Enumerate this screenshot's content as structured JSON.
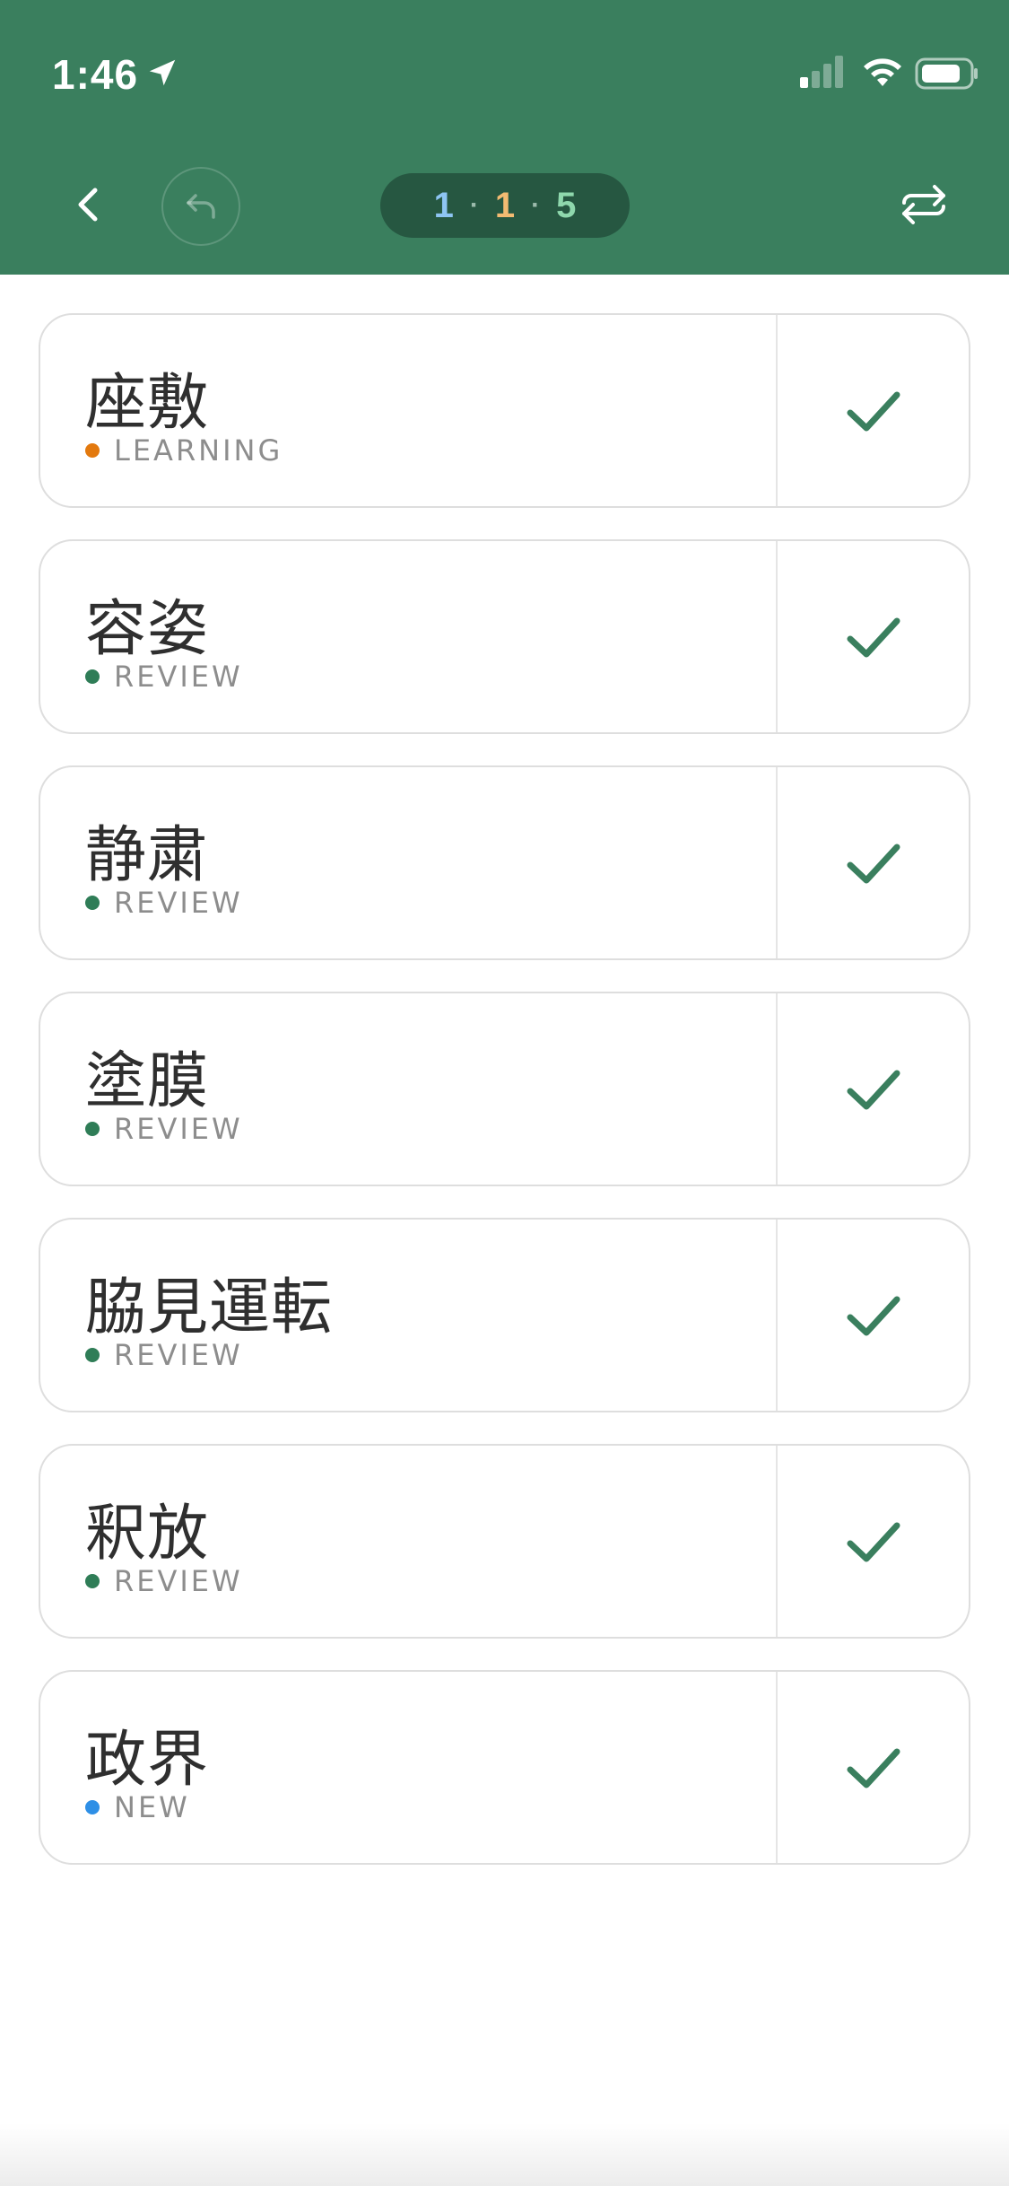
{
  "status_bar": {
    "time": "1:46"
  },
  "header": {
    "counts": {
      "new": "1",
      "learning": "1",
      "review": "5"
    },
    "colors": {
      "new": "#8ec5f2",
      "learning": "#f3bb72",
      "review": "#8fd8ad"
    }
  },
  "cards": [
    {
      "term": "座敷",
      "status": "LEARNING",
      "dot_color": "#e3790e"
    },
    {
      "term": "容姿",
      "status": "REVIEW",
      "dot_color": "#2f7d57"
    },
    {
      "term": "静粛",
      "status": "REVIEW",
      "dot_color": "#2f7d57"
    },
    {
      "term": "塗膜",
      "status": "REVIEW",
      "dot_color": "#2f7d57"
    },
    {
      "term": "脇見運転",
      "status": "REVIEW",
      "dot_color": "#2f7d57"
    },
    {
      "term": "釈放",
      "status": "REVIEW",
      "dot_color": "#2f7d57"
    },
    {
      "term": "政界",
      "status": "NEW",
      "dot_color": "#2e8fe6"
    }
  ],
  "icons": {
    "back": "chevron-left-icon",
    "undo": "undo-icon",
    "swap": "swap-arrows-icon",
    "check": "checkmark-icon"
  },
  "theme": {
    "header": "#3a7f5e",
    "check": "#3a7f5e"
  }
}
